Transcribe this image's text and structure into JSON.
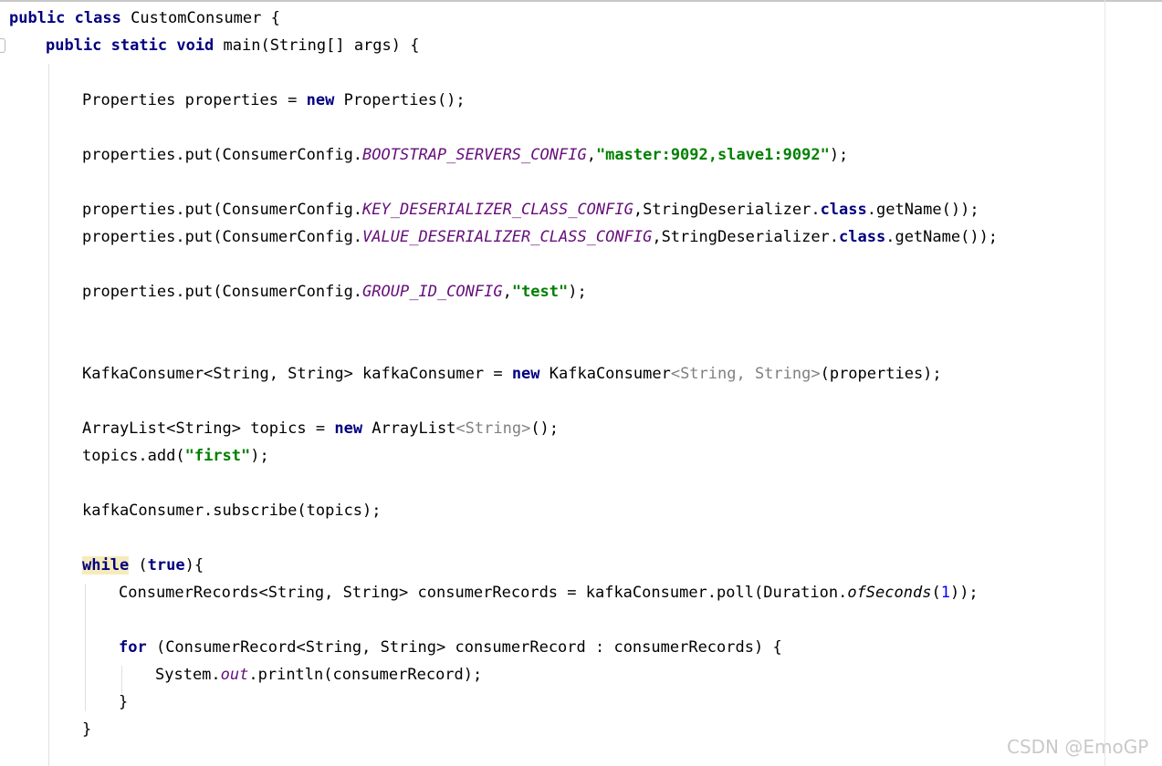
{
  "editor": {
    "lines": [
      {
        "indent": 0,
        "segments": [
          {
            "t": "public",
            "c": "kw"
          },
          {
            "t": " "
          },
          {
            "t": "class",
            "c": "kw"
          },
          {
            "t": " CustomConsumer {"
          }
        ]
      },
      {
        "indent": 1,
        "segments": [
          {
            "t": "public",
            "c": "kw"
          },
          {
            "t": " "
          },
          {
            "t": "static",
            "c": "kw"
          },
          {
            "t": " "
          },
          {
            "t": "void",
            "c": "kw"
          },
          {
            "t": " main(String[] args) {"
          }
        ]
      },
      {
        "indent": 2,
        "segments": []
      },
      {
        "indent": 2,
        "segments": [
          {
            "t": "Properties properties = "
          },
          {
            "t": "new",
            "c": "kw"
          },
          {
            "t": " Properties();"
          }
        ]
      },
      {
        "indent": 2,
        "segments": []
      },
      {
        "indent": 2,
        "segments": [
          {
            "t": "properties.put(ConsumerConfig."
          },
          {
            "t": "BOOTSTRAP_SERVERS_CONFIG",
            "c": "fld"
          },
          {
            "t": ","
          },
          {
            "t": "\"master:9092,slave1:9092\"",
            "c": "str"
          },
          {
            "t": ");"
          }
        ]
      },
      {
        "indent": 2,
        "segments": []
      },
      {
        "indent": 2,
        "segments": [
          {
            "t": "properties.put(ConsumerConfig."
          },
          {
            "t": "KEY_DESERIALIZER_CLASS_CONFIG",
            "c": "fld"
          },
          {
            "t": ",StringDeserializer."
          },
          {
            "t": "class",
            "c": "kw"
          },
          {
            "t": ".getName());"
          }
        ]
      },
      {
        "indent": 2,
        "segments": [
          {
            "t": "properties.put(ConsumerConfig."
          },
          {
            "t": "VALUE_DESERIALIZER_CLASS_CONFIG",
            "c": "fld"
          },
          {
            "t": ",StringDeserializer."
          },
          {
            "t": "class",
            "c": "kw"
          },
          {
            "t": ".getName());"
          }
        ]
      },
      {
        "indent": 2,
        "segments": []
      },
      {
        "indent": 2,
        "segments": [
          {
            "t": "properties.put(ConsumerConfig."
          },
          {
            "t": "GROUP_ID_CONFIG",
            "c": "fld"
          },
          {
            "t": ","
          },
          {
            "t": "\"test\"",
            "c": "str"
          },
          {
            "t": ");"
          }
        ]
      },
      {
        "indent": 2,
        "segments": []
      },
      {
        "indent": 2,
        "segments": []
      },
      {
        "indent": 2,
        "segments": [
          {
            "t": "KafkaConsumer<String, String> kafkaConsumer = "
          },
          {
            "t": "new",
            "c": "kw"
          },
          {
            "t": " KafkaConsumer"
          },
          {
            "t": "<String, String>",
            "c": "gen"
          },
          {
            "t": "(properties);"
          }
        ]
      },
      {
        "indent": 2,
        "segments": []
      },
      {
        "indent": 2,
        "segments": [
          {
            "t": "ArrayList<String> topics = "
          },
          {
            "t": "new",
            "c": "kw"
          },
          {
            "t": " ArrayList"
          },
          {
            "t": "<String>",
            "c": "gen"
          },
          {
            "t": "();"
          }
        ]
      },
      {
        "indent": 2,
        "segments": [
          {
            "t": "topics.add("
          },
          {
            "t": "\"first\"",
            "c": "str"
          },
          {
            "t": ");"
          }
        ]
      },
      {
        "indent": 2,
        "segments": []
      },
      {
        "indent": 2,
        "segments": [
          {
            "t": "kafkaConsumer.subscribe(topics);"
          }
        ]
      },
      {
        "indent": 2,
        "segments": []
      },
      {
        "indent": 2,
        "segments": [
          {
            "t": "while",
            "c": "kw hl"
          },
          {
            "t": " ("
          },
          {
            "t": "true",
            "c": "kw"
          },
          {
            "t": "){"
          }
        ]
      },
      {
        "indent": 3,
        "segments": [
          {
            "t": "ConsumerRecords<String, String> consumerRecords = kafkaConsumer.poll(Duration."
          },
          {
            "t": "ofSeconds",
            "c": "sfn"
          },
          {
            "t": "("
          },
          {
            "t": "1",
            "c": "num"
          },
          {
            "t": "));"
          }
        ]
      },
      {
        "indent": 3,
        "segments": []
      },
      {
        "indent": 3,
        "segments": [
          {
            "t": "for",
            "c": "kw"
          },
          {
            "t": " (ConsumerRecord<String, String> consumerRecord : consumerRecords) {"
          }
        ]
      },
      {
        "indent": 4,
        "segments": [
          {
            "t": "System."
          },
          {
            "t": "out",
            "c": "fld"
          },
          {
            "t": ".println(consumerRecord);"
          }
        ]
      },
      {
        "indent": 3,
        "segments": [
          {
            "t": "}"
          }
        ]
      },
      {
        "indent": 2,
        "segments": [
          {
            "t": "}"
          }
        ]
      }
    ]
  },
  "watermark": {
    "text": "CSDN @EmoGP"
  }
}
